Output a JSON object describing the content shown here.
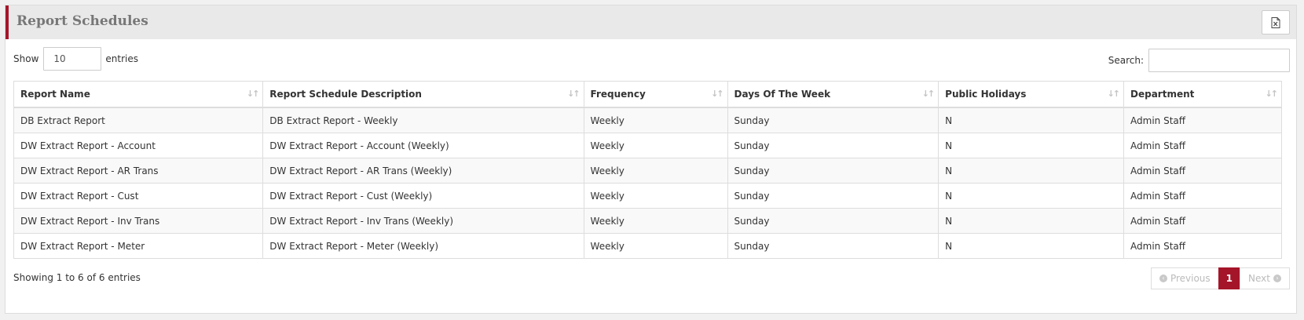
{
  "header": {
    "title": "Report Schedules",
    "export_icon": "excel-export-icon"
  },
  "controls": {
    "show_label": "Show",
    "entries_value": "10",
    "entries_label": "entries",
    "search_label": "Search:",
    "search_value": ""
  },
  "table": {
    "columns": [
      "Report Name",
      "Report Schedule Description",
      "Frequency",
      "Days Of The Week",
      "Public Holidays",
      "Department"
    ],
    "rows": [
      [
        "DB Extract Report",
        "DB Extract Report - Weekly",
        "Weekly",
        "Sunday",
        "N",
        "Admin Staff"
      ],
      [
        "DW Extract Report - Account",
        "DW Extract Report - Account (Weekly)",
        "Weekly",
        "Sunday",
        "N",
        "Admin Staff"
      ],
      [
        "DW Extract Report - AR Trans",
        "DW Extract Report - AR Trans (Weekly)",
        "Weekly",
        "Sunday",
        "N",
        "Admin Staff"
      ],
      [
        "DW Extract Report - Cust",
        "DW Extract Report - Cust (Weekly)",
        "Weekly",
        "Sunday",
        "N",
        "Admin Staff"
      ],
      [
        "DW Extract Report - Inv Trans",
        "DW Extract Report - Inv Trans (Weekly)",
        "Weekly",
        "Sunday",
        "N",
        "Admin Staff"
      ],
      [
        "DW Extract Report - Meter",
        "DW Extract Report - Meter (Weekly)",
        "Weekly",
        "Sunday",
        "N",
        "Admin Staff"
      ]
    ]
  },
  "footer": {
    "info": "Showing 1 to 6 of 6 entries",
    "previous_label": "Previous",
    "current_page": "1",
    "next_label": "Next"
  },
  "colors": {
    "accent": "#a5152a",
    "header_bg": "#e9e9e9",
    "stripe": "#f9f9f9"
  }
}
